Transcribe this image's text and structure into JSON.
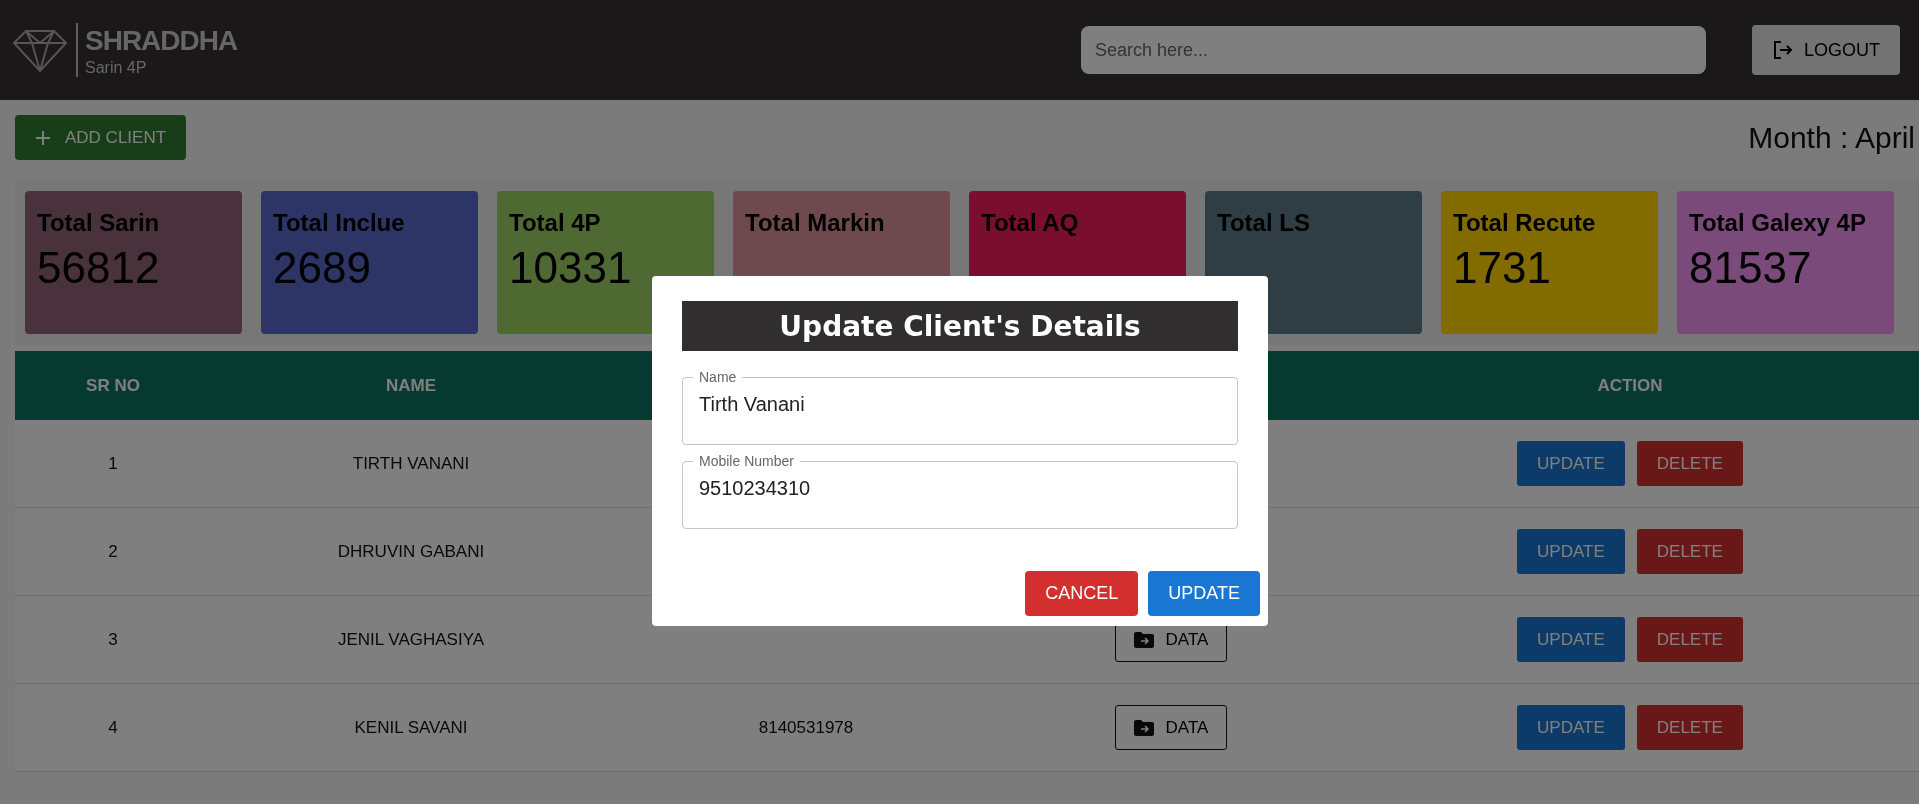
{
  "header": {
    "brand": "SHRADDHA",
    "subtitle": "Sarin 4P",
    "search": {
      "placeholder": "Search here..."
    },
    "logout": "LOGOUT"
  },
  "toolbar": {
    "add_button": "ADD CLIENT",
    "month": "Month : April"
  },
  "cards": [
    {
      "title": "Total Sarin",
      "value": "56812",
      "color": "#4a323c"
    },
    {
      "title": "Total Inclue",
      "value": "2689",
      "color": "#2c3566"
    },
    {
      "title": "Total 4P",
      "value": "10331",
      "color": "#4e6a32"
    },
    {
      "title": "Total Markin",
      "color": "#6e4a4e"
    },
    {
      "title": "Total AQ",
      "color": "#7a0e30"
    },
    {
      "title": "Total LS",
      "color": "#2e3e44"
    },
    {
      "title": "Total Recute",
      "value": "1731",
      "color": "#826c00"
    },
    {
      "title": "Total Galexy 4P",
      "value": "81537",
      "color": "#7a4a7a"
    }
  ],
  "table": {
    "columns": {
      "sr_no": "SR NO",
      "name": "NAME",
      "action": "ACTION"
    },
    "rows": [
      {
        "sr_no": "1",
        "name": "TIRTH VANANI",
        "update": "UPDATE",
        "delete": "DELETE"
      },
      {
        "sr_no": "2",
        "name": "DHRUVIN GABANI",
        "update": "UPDATE",
        "delete": "DELETE"
      },
      {
        "sr_no": "3",
        "name": "JENIL VAGHASIYA",
        "data_button": "DATA",
        "update": "UPDATE",
        "delete": "DELETE"
      },
      {
        "sr_no": "4",
        "name": "KENIL SAVANI",
        "mobile": "8140531978",
        "data_button": "DATA",
        "update": "UPDATE",
        "delete": "DELETE"
      }
    ]
  },
  "dialog": {
    "title": "Update Client's Details",
    "fields": [
      {
        "label": "Name",
        "value": "Tirth Vanani"
      },
      {
        "label": "Mobile Number",
        "value": "9510234310"
      }
    ],
    "cancel": "CANCEL",
    "update": "UPDATE"
  }
}
